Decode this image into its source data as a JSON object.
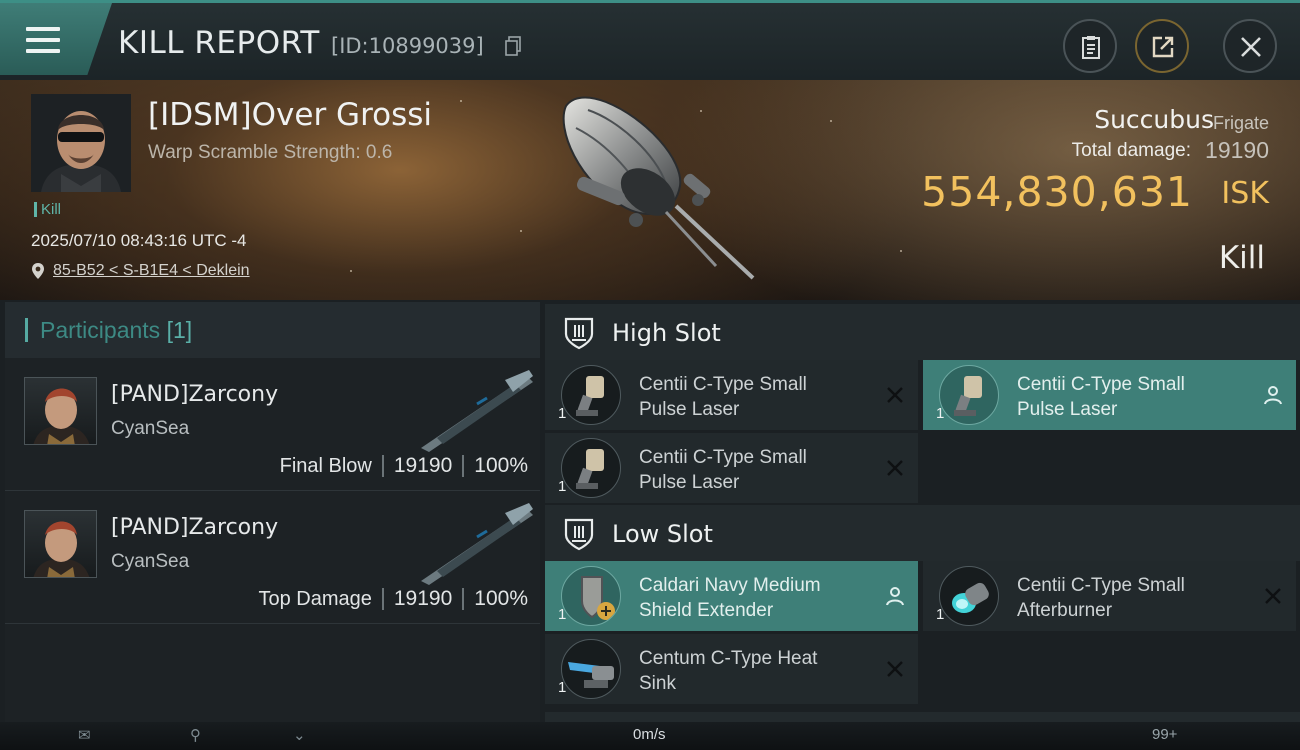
{
  "header": {
    "title": "KILL REPORT",
    "report_id": "[ID:10899039]"
  },
  "victim": {
    "name": "[IDSM]Over Grossi",
    "warp_scramble": "Warp Scramble Strength: 0.6",
    "kill_tag": "Kill",
    "timestamp": "2025/07/10 08:43:16 UTC -4",
    "location": "85-B52 < S-B1E4 < Deklein",
    "ship_name": "Succubus",
    "ship_class": "Frigate",
    "total_damage_label": "Total damage:",
    "total_damage": "19190",
    "isk_value": "554,830,631",
    "isk_unit": "ISK",
    "status": "Kill"
  },
  "participants": {
    "title": "Participants",
    "count": "[1]",
    "rows": [
      {
        "name": "[PAND]Zarcony",
        "corp": "CyanSea",
        "label": "Final Blow",
        "damage": "19190",
        "percent": "100%"
      },
      {
        "name": "[PAND]Zarcony",
        "corp": "CyanSea",
        "label": "Top Damage",
        "damage": "19190",
        "percent": "100%"
      }
    ]
  },
  "slots": {
    "high": {
      "title": "High Slot",
      "items": [
        {
          "qty": "1",
          "line1": "Centii C-Type Small",
          "line2": "Pulse Laser",
          "state": "destroyed"
        },
        {
          "qty": "1",
          "line1": "Centii C-Type Small",
          "line2": "Pulse Laser",
          "state": "dropped"
        },
        {
          "qty": "1",
          "line1": "Centii C-Type Small",
          "line2": "Pulse Laser",
          "state": "destroyed"
        }
      ]
    },
    "low": {
      "title": "Low Slot",
      "items": [
        {
          "qty": "1",
          "line1": "Caldari Navy Medium",
          "line2": "Shield Extender",
          "state": "dropped"
        },
        {
          "qty": "1",
          "line1": "Centii C-Type Small",
          "line2": "Afterburner",
          "state": "destroyed"
        },
        {
          "qty": "1",
          "line1": "Centum C-Type Heat",
          "line2": "Sink",
          "state": "destroyed"
        }
      ]
    }
  },
  "bottom_bar": {
    "speed": "0m/s",
    "badge": "99+"
  },
  "colors": {
    "accent": "#3d8f86",
    "highlight_row": "#3e7f78",
    "isk": "#f2c15e"
  },
  "icons": [
    "menu-icon",
    "copy-icon",
    "clipboard-icon",
    "share-icon",
    "close-icon",
    "location-pin-icon",
    "slot-shield-icon",
    "x-icon",
    "person-icon"
  ]
}
